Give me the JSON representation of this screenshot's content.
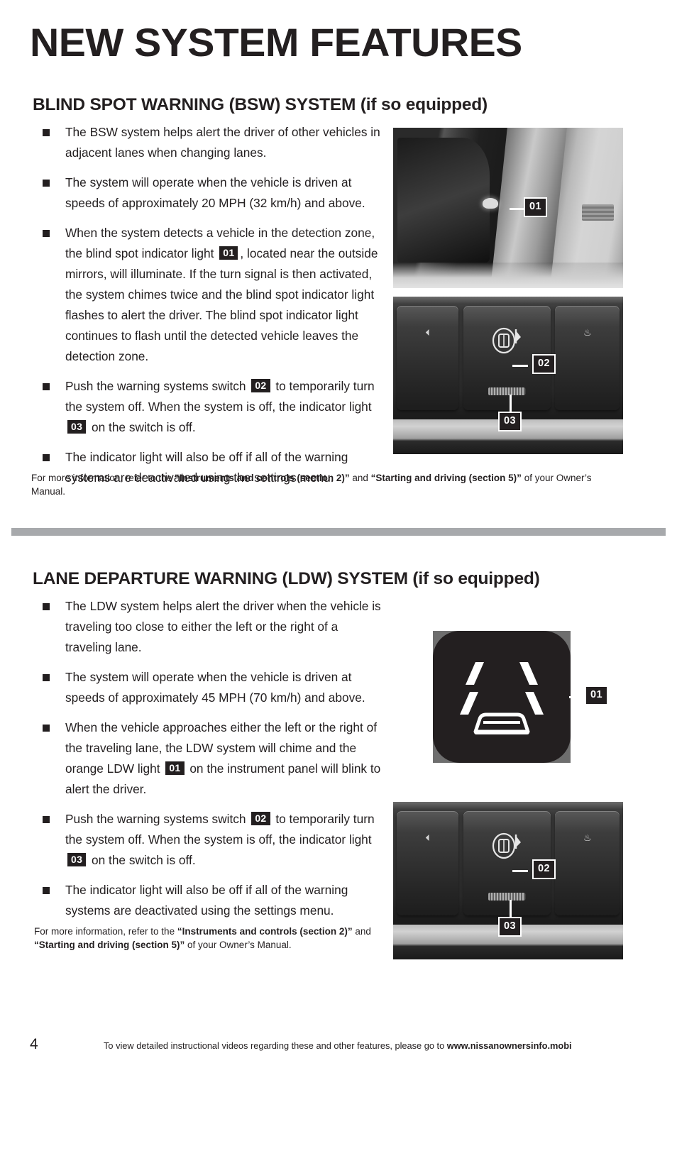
{
  "page": {
    "title": "NEW SYSTEM FEATURES",
    "folio": "4",
    "footer_note_prefix": "To view detailed instructional videos regarding these and other features, please go to ",
    "footer_note_url": "www.nissanownersinfo.mobi"
  },
  "sections": [
    {
      "id": "bsw",
      "heading_main": "BLIND SPOT WARNING (BSW) SYSTEM ",
      "heading_sub": "(if so equipped)",
      "bullets": [
        {
          "parts": [
            {
              "t": "text",
              "v": "The BSW system helps alert the driver of other vehicles in adjacent lanes when changing lanes."
            }
          ]
        },
        {
          "parts": [
            {
              "t": "text",
              "v": "The system will operate when the vehicle is driven at speeds of approximately 20 MPH (32 km/h) and above."
            }
          ]
        },
        {
          "parts": [
            {
              "t": "text",
              "v": "When the system detects a vehicle in the detection zone, the blind spot indicator light "
            },
            {
              "t": "chip",
              "v": "01"
            },
            {
              "t": "text",
              "v": ", located near the outside mirrors, will illuminate. If the turn signal is then activated, the system chimes twice and the blind spot indicator light flashes to alert the driver. The blind spot indicator light continues to flash until the detected vehicle leaves the detection zone."
            }
          ]
        },
        {
          "parts": [
            {
              "t": "text",
              "v": "Push the warning systems switch "
            },
            {
              "t": "chip",
              "v": "02"
            },
            {
              "t": "text",
              "v": " to temporarily turn the system off. When the system is off, the indicator light "
            },
            {
              "t": "chip",
              "v": "03"
            },
            {
              "t": "text",
              "v": " on the switch is off."
            }
          ]
        },
        {
          "parts": [
            {
              "t": "text",
              "v": "The indicator light will also be off if all of the warning systems are deactivated using the settings menu."
            }
          ]
        }
      ],
      "footnote": [
        {
          "t": "text",
          "v": "For more information, refer to the "
        },
        {
          "t": "bold",
          "v": "“Instruments and controls (section 2)”"
        },
        {
          "t": "text",
          "v": " and "
        },
        {
          "t": "bold",
          "v": "“Starting and driving (section 5)”"
        },
        {
          "t": "text",
          "v": " of your Owner’s Manual."
        }
      ]
    },
    {
      "id": "ldw",
      "heading_main": "LANE DEPARTURE WARNING (LDW) SYSTEM ",
      "heading_sub": "(if so equipped)",
      "bullets": [
        {
          "parts": [
            {
              "t": "text",
              "v": "The LDW system helps alert the driver when the vehicle is traveling too close to either the left or the right of a traveling lane."
            }
          ]
        },
        {
          "parts": [
            {
              "t": "text",
              "v": "The system will operate when the vehicle is driven at speeds of approximately 45 MPH (70 km/h) and above."
            }
          ]
        },
        {
          "parts": [
            {
              "t": "text",
              "v": "When the vehicle approaches either the left or the right of the traveling lane, the LDW system will chime and the orange LDW light "
            },
            {
              "t": "chip",
              "v": "01"
            },
            {
              "t": "text",
              "v": " on the instrument panel will blink to alert the driver."
            }
          ]
        },
        {
          "parts": [
            {
              "t": "text",
              "v": "Push the warning systems switch "
            },
            {
              "t": "chip",
              "v": "02"
            },
            {
              "t": "text",
              "v": " to temporarily turn the system off. When the system is off, the indicator light "
            },
            {
              "t": "chip",
              "v": "03"
            },
            {
              "t": "text",
              "v": " on the switch is off."
            }
          ]
        },
        {
          "parts": [
            {
              "t": "text",
              "v": "The indicator light will also be off if all of the warning systems are deactivated using the settings menu."
            }
          ]
        }
      ],
      "footnote": [
        {
          "t": "text",
          "v": "For more information, refer to the "
        },
        {
          "t": "bold",
          "v": "“Instruments and controls (section 2)”"
        },
        {
          "t": "text",
          "v": " and "
        },
        {
          "t": "bold",
          "v": "“Starting and driving (section 5)”"
        },
        {
          "t": "text",
          "v": " of your Owner’s Manual."
        }
      ]
    }
  ],
  "callouts": {
    "bsw_mirror": "01",
    "bsw_switch_02": "02",
    "bsw_switch_03": "03",
    "ldw_icon": "01",
    "ldw_switch_02": "02",
    "ldw_switch_03": "03"
  },
  "images": {
    "mirror_photo_alt": "outside-mirror-blind-spot-indicator-photo",
    "switch_photo_alt": "warning-systems-switch-photo",
    "ldw_icon_alt": "lane-departure-warning-icon"
  },
  "colors": {
    "ink": "#231f20",
    "divider_grey": "#a7a9ac",
    "paper": "#ffffff"
  }
}
